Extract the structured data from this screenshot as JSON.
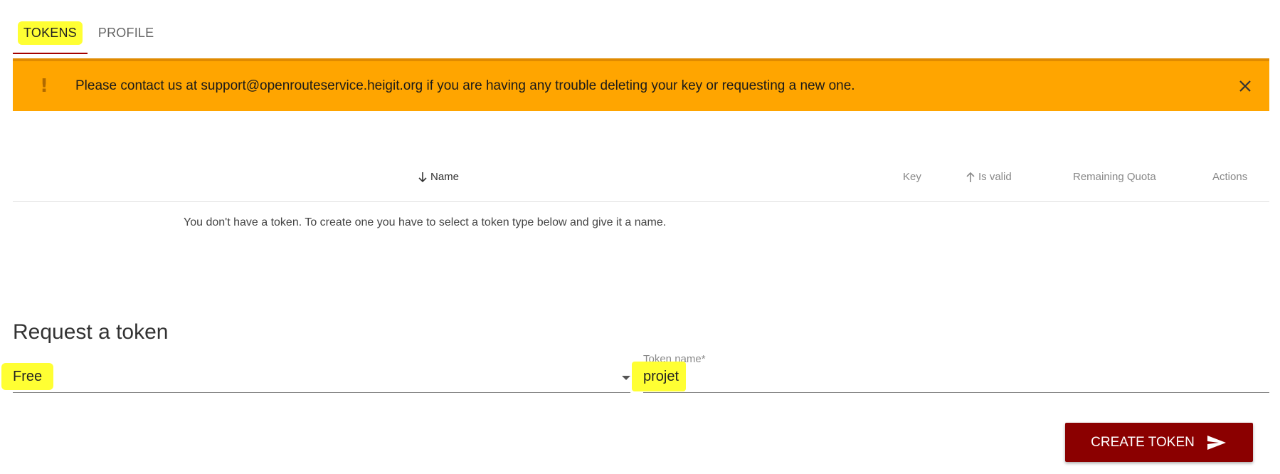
{
  "tabs": [
    {
      "label": "TOKENS",
      "active": true
    },
    {
      "label": "PROFILE",
      "active": false
    }
  ],
  "banner": {
    "icon": "exclamation-icon",
    "text": "Please contact us at support@openrouteservice.heigit.org if you are having any trouble deleting your key or requesting a new one.",
    "close_icon": "close-icon",
    "background": "#ffa500"
  },
  "table": {
    "columns": [
      {
        "label": "Name",
        "sort": "down"
      },
      {
        "label": "Key"
      },
      {
        "label": "Is valid",
        "sort": "up"
      },
      {
        "label": "Remaining Quota"
      },
      {
        "label": "Actions"
      }
    ],
    "empty_message": "You don't have a token. To create one you have to select a token type below and give it a name."
  },
  "request": {
    "title": "Request a token",
    "type_select": {
      "value": "Free"
    },
    "token_name": {
      "label": "Token name*",
      "value": "projet"
    },
    "create_button": {
      "label": "CREATE TOKEN",
      "icon": "send-icon",
      "color": "#8b0000"
    }
  }
}
